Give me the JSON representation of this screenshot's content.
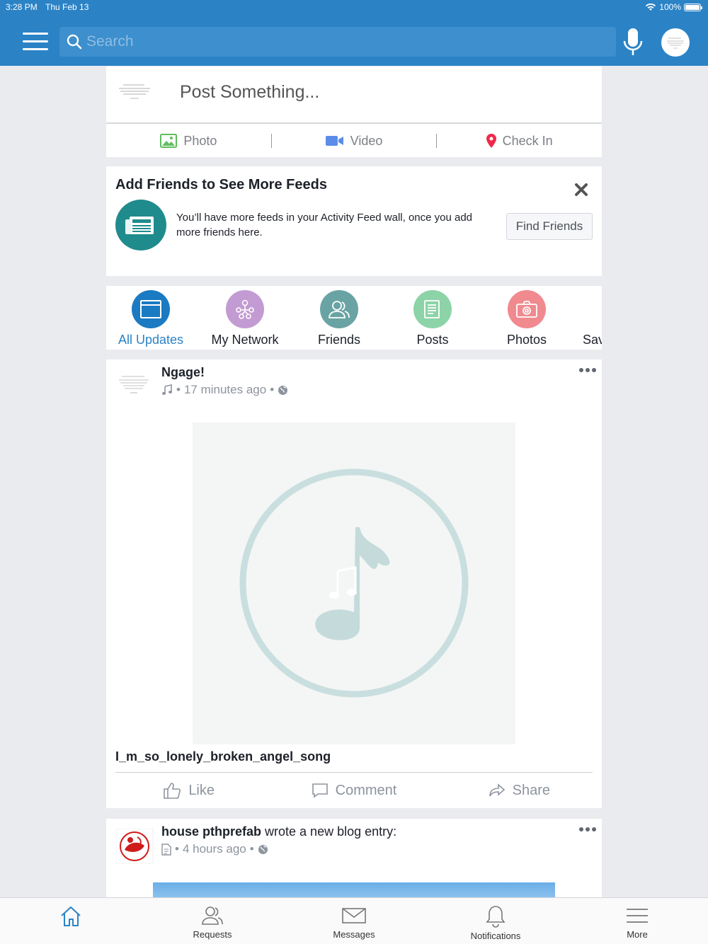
{
  "status_bar": {
    "time": "3:28 PM",
    "date": "Thu Feb 13",
    "battery": "100%"
  },
  "header": {
    "search_placeholder": "Search"
  },
  "composer": {
    "placeholder": "Post Something...",
    "actions": [
      {
        "label": "Photo",
        "icon": "photo-icon",
        "color": "#5ebd5e"
      },
      {
        "label": "Video",
        "icon": "video-icon",
        "color": "#5b8de8"
      },
      {
        "label": "Check In",
        "icon": "location-pin-icon",
        "color": "#f0284a"
      }
    ]
  },
  "add_friends": {
    "title": "Add Friends to See More Feeds",
    "description": "You’ll have more feeds in your Activity Feed wall, once you add more friends here.",
    "button": "Find Friends",
    "icon": "newspaper-icon"
  },
  "filters": [
    {
      "label": "All Updates",
      "icon": "window-icon",
      "color": "#1a7ac2",
      "active": true
    },
    {
      "label": "My Network",
      "icon": "network-icon",
      "color": "#c39bd3"
    },
    {
      "label": "Friends",
      "icon": "friends-icon",
      "color": "#6aa3a3"
    },
    {
      "label": "Posts",
      "icon": "posts-icon",
      "color": "#8dd3a8"
    },
    {
      "label": "Photos",
      "icon": "camera-icon",
      "color": "#f08a8f"
    },
    {
      "label": "Sav",
      "icon": "",
      "color": "#ffffff"
    }
  ],
  "posts": [
    {
      "author": "Ngage!",
      "meta_icon": "music-note-icon",
      "time": "17 minutes ago",
      "privacy_icon": "globe-icon",
      "media_icon": "music-circle-icon",
      "title": "I_m_so_lonely_broken_angel_song",
      "actions": {
        "like": "Like",
        "comment": "Comment",
        "share": "Share"
      }
    },
    {
      "author": "house pthprefab",
      "action_text": "wrote a new blog entry:",
      "meta_icon": "document-icon",
      "time": "4 hours ago",
      "privacy_icon": "globe-icon"
    }
  ],
  "tabbar": [
    {
      "label": "",
      "icon": "home-icon",
      "active": true
    },
    {
      "label": "Requests",
      "icon": "requests-icon"
    },
    {
      "label": "Messages",
      "icon": "envelope-icon"
    },
    {
      "label": "Notifications",
      "icon": "bell-icon"
    },
    {
      "label": "More",
      "icon": "menu-icon"
    }
  ],
  "colors": {
    "brand": "#2b83c6",
    "accent_active": "#2b83c6"
  }
}
